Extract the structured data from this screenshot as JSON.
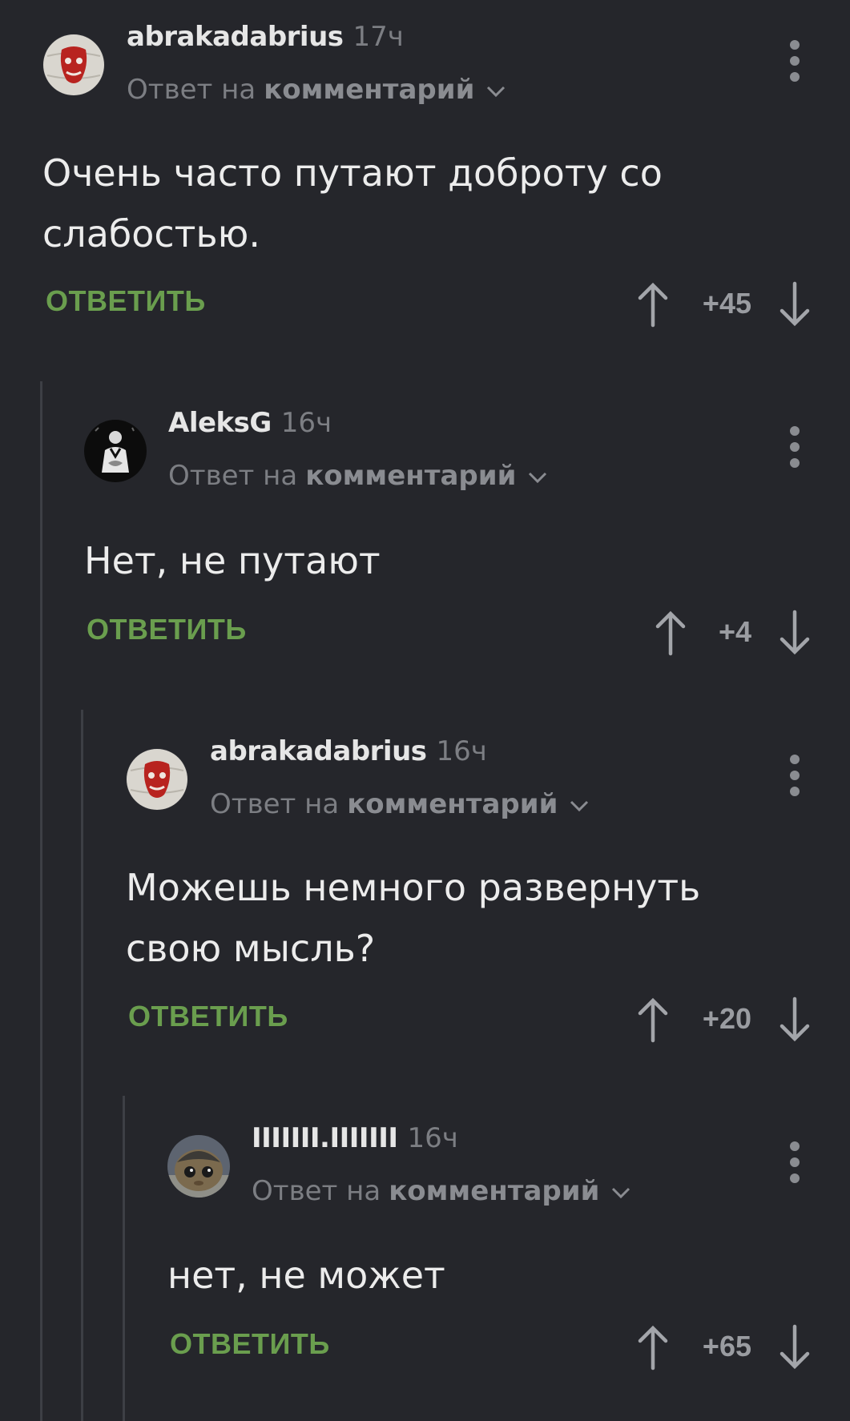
{
  "reply_prefix": "Ответ на",
  "comments": [
    {
      "author": "abrakadabrius",
      "time": "17ч",
      "reply_link": "комментарий",
      "text": "Очень часто путают доброту со слабостью.",
      "reply_button": "ОТВЕТИТЬ",
      "score": "+45",
      "avatar": "ball-face-avatar"
    },
    {
      "author": "AleksG",
      "time": "16ч",
      "reply_link": "комментарий",
      "text": "Нет, не путают",
      "reply_button": "ОТВЕТИТЬ",
      "score": "+4",
      "avatar": "godfather-avatar"
    },
    {
      "author": "abrakadabrius",
      "time": "16ч",
      "reply_link": "комментарий",
      "text": "Можешь немного развернуть свою мысль?",
      "reply_button": "ОТВЕТИТЬ",
      "score": "+20",
      "avatar": "ball-face-avatar"
    },
    {
      "author": "IIIIIII.IIIIIII",
      "time": "16ч",
      "reply_link": "комментарий",
      "text": "нет, не может",
      "reply_button": "ОТВЕТИТЬ",
      "score": "+65",
      "avatar": "creature-avatar"
    }
  ],
  "colors": {
    "background": "#25262b",
    "reply_button": "#6a9e4e",
    "muted": "#7c7e83",
    "thread_line": "#3d3f45"
  }
}
